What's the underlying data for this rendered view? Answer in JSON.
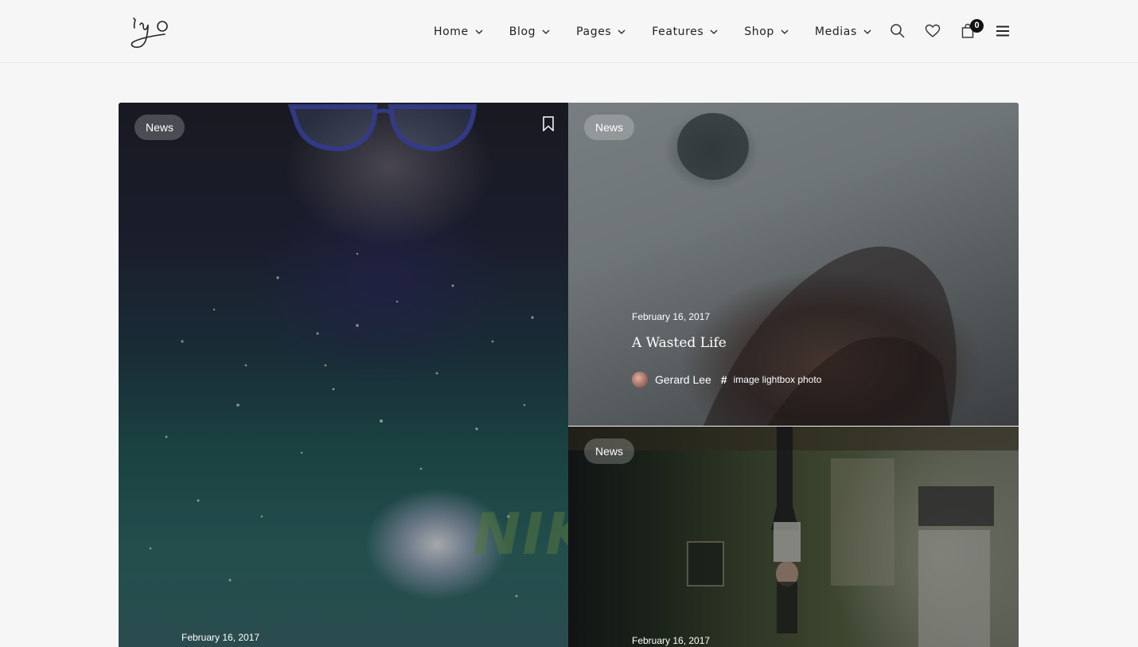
{
  "header": {
    "logo_text": "iyo",
    "nav": [
      {
        "label": "Home"
      },
      {
        "label": "Blog"
      },
      {
        "label": "Pages"
      },
      {
        "label": "Features"
      },
      {
        "label": "Shop"
      },
      {
        "label": "Medias"
      }
    ],
    "cart_count": "0",
    "icons": [
      "search-icon",
      "heart-icon",
      "shopping-bag-icon",
      "menu-icon"
    ]
  },
  "posts": [
    {
      "category": "News",
      "date": "February 16, 2017",
      "bookmark_icon": "bookmark-icon"
    },
    {
      "category": "News",
      "date": "February 16, 2017",
      "title": "A Wasted Life",
      "author": "Gerard Lee",
      "tags": "image lightbox photo",
      "tag_icon": "hash-icon"
    },
    {
      "category": "News",
      "date": "February 16, 2017"
    }
  ],
  "colors": {
    "background": "#f6f6f6",
    "text": "#222222",
    "cart_badge": "#111111"
  }
}
